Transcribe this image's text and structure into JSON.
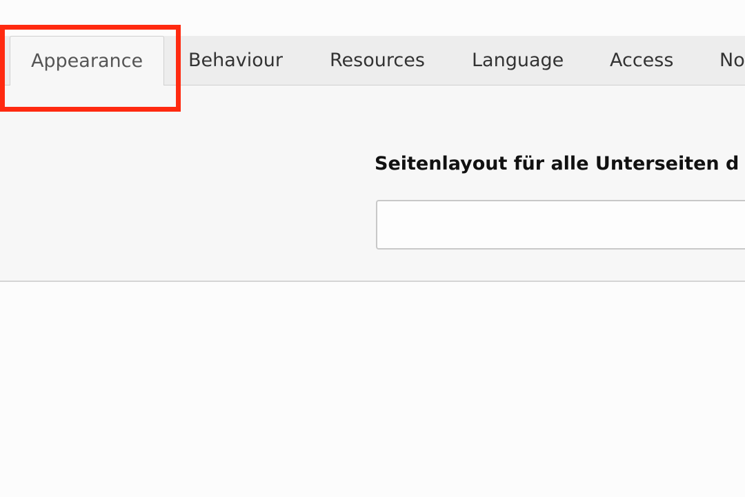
{
  "tabs": [
    {
      "label": "Appearance",
      "active": true
    },
    {
      "label": "Behaviour",
      "active": false
    },
    {
      "label": "Resources",
      "active": false
    },
    {
      "label": "Language",
      "active": false
    },
    {
      "label": "Access",
      "active": false
    },
    {
      "label": "No",
      "active": false
    }
  ],
  "panel": {
    "field_label": "Seitenlayout für alle Unterseiten d",
    "field_value": ""
  },
  "colors": {
    "highlight": "#ff2a10",
    "tabbar_bg": "#ededed",
    "panel_bg": "#f7f7f7"
  }
}
